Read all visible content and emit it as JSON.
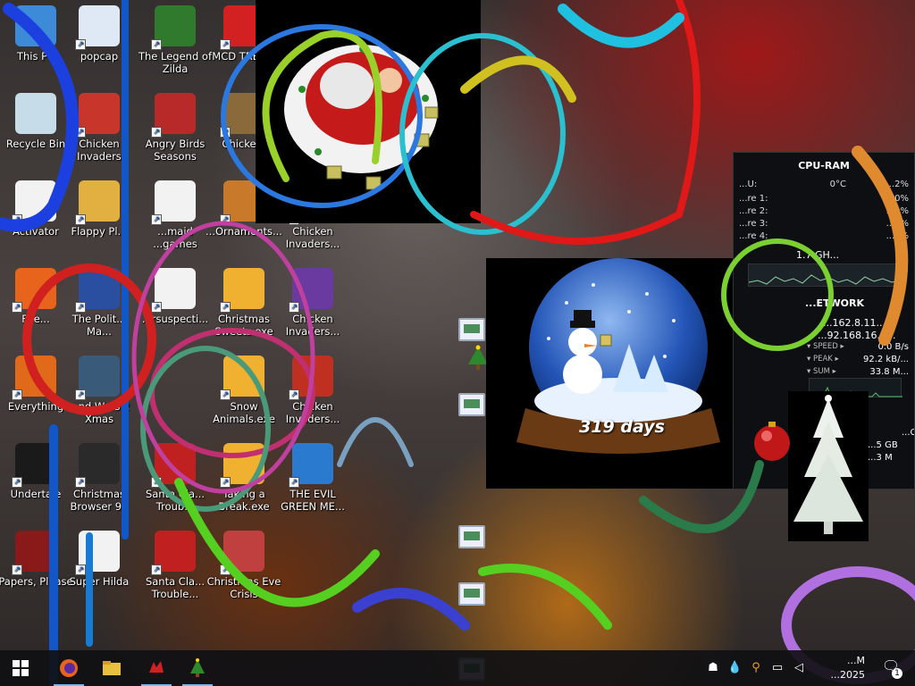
{
  "desktop": {
    "icons": [
      {
        "label": "This PC",
        "icon": "computer-icon",
        "color": "#3d8bd8"
      },
      {
        "label": "popcap",
        "icon": "popcap-icon",
        "color": "#dfe8f5"
      },
      {
        "label": "The Legend of Zilda",
        "icon": "zelda-icon",
        "color": "#2f7a2c"
      },
      {
        "label": "MCD TREA...",
        "icon": "mcdonalds-icon",
        "color": "#d32020"
      },
      {
        "label": "Recycle Bin",
        "icon": "recycle-bin-icon",
        "color": "#c6dce8"
      },
      {
        "label": "Chicken Invaders",
        "icon": "chicken-invaders-icon",
        "color": "#c8352a"
      },
      {
        "label": "Angry Birds Seasons",
        "icon": "angry-birds-icon",
        "color": "#b8292a"
      },
      {
        "label": "Chicke...",
        "icon": "chicken-icon",
        "color": "#8a6a3a"
      },
      {
        "label": "Activator",
        "icon": "document-icon",
        "color": "#f2f2f2"
      },
      {
        "label": "Flappy Pl...",
        "icon": "flappy-icon",
        "color": "#e2b040"
      },
      {
        "label": "...maid ...games",
        "icon": "document-icon",
        "color": "#f2f2f2"
      },
      {
        "label": "...Ornaments...",
        "icon": "ornaments-icon",
        "color": "#c87a2a"
      },
      {
        "label": "Chicken Invaders...",
        "icon": "chicken-invaders-icon",
        "color": "#a05a2a"
      },
      {
        "label": "Fire...",
        "icon": "firefox-icon",
        "color": "#e8641c"
      },
      {
        "label": "The Polit... Ma...",
        "icon": "politics-icon",
        "color": "#2a4fa0"
      },
      {
        "label": "...rsuspecti...",
        "icon": "document-icon",
        "color": "#f2f2f2"
      },
      {
        "label": "Christmas Sweets.exe",
        "icon": "installer-icon",
        "color": "#f0b030"
      },
      {
        "label": "Chicken Invaders...",
        "icon": "chicken-invaders-icon",
        "color": "#6a3aa0"
      },
      {
        "label": "Everything",
        "icon": "search-app-icon",
        "color": "#e06a1a"
      },
      {
        "label": "...nd Wars 2 Xmas",
        "icon": "wars-icon",
        "color": "#3a5a7a"
      },
      {
        "label": "Snow Animals.exe",
        "icon": "installer-icon",
        "color": "#f0b030"
      },
      {
        "label": "Chicken Invaders...",
        "icon": "chicken-invaders-icon",
        "color": "#c03020"
      },
      {
        "label": "Undertale",
        "icon": "undertale-icon",
        "color": "#1a1a1a"
      },
      {
        "label": "Christmas Browser 99",
        "icon": "browser-icon",
        "color": "#2a2a2a"
      },
      {
        "label": "Santa Cla... Troub...",
        "icon": "santa-icon",
        "color": "#c02020"
      },
      {
        "label": "Taking a Break.exe",
        "icon": "installer-icon",
        "color": "#f0b030"
      },
      {
        "label": "THE EVIL GREEN ME...",
        "icon": "evil-green-icon",
        "color": "#2a7ad0"
      },
      {
        "label": "Papers, Please",
        "icon": "papers-please-icon",
        "color": "#8a1a1a"
      },
      {
        "label": "Super Hilda",
        "icon": "hilda-icon",
        "color": "#f2f2f2"
      },
      {
        "label": "Santa Cla... Trouble...",
        "icon": "santa-icon",
        "color": "#c02020"
      },
      {
        "label": "Christmas Eve Crisis",
        "icon": "christmas-eve-icon",
        "color": "#c04040"
      }
    ]
  },
  "gadgets": {
    "snow_globe": {
      "days_label": "319 days"
    },
    "cpu_ram": {
      "title": "CPU-RAM",
      "rows": [
        {
          "k": "...U:",
          "v": "0°C"
        },
        {
          "k": "...re 1:",
          "v": "...0%"
        },
        {
          "k": "...re 2:",
          "v": "...0%"
        },
        {
          "k": "...re 3:",
          "v": "...0%"
        },
        {
          "k": "...re 4:",
          "v": "...0%"
        }
      ],
      "total_label": "...2%",
      "freq": "1.7 GH...",
      "network_title": "...ETWORK",
      "ip1": "...162.8.11...",
      "ip2": "...92.168.16.2...",
      "stats": [
        {
          "k": "▾ SPEED ▸",
          "v": "0.0 B/s"
        },
        {
          "k": "▾ PEAK ▸",
          "v": "92.2 kB/..."
        },
        {
          "k": "▾ SUM ▸",
          "v": "33.8 M..."
        }
      ],
      "sys1": "...C",
      "sys2": "...5 GB",
      "sys3": "...3 M"
    }
  },
  "taskbar": {
    "start_icon": "windows-start-icon",
    "pinned": [
      "firefox-icon",
      "folder-icon",
      "red-dragon-icon",
      "christmas-tree-icon"
    ],
    "clock_time": "...M",
    "clock_date": "...2025",
    "notification_count": "1",
    "tray": [
      "people-icon",
      "droplet-icon",
      "search-icon",
      "network-icon",
      "speaker-icon"
    ]
  },
  "colors": {
    "taskbar_bg": "#101014",
    "accent": "#76b9ed"
  }
}
